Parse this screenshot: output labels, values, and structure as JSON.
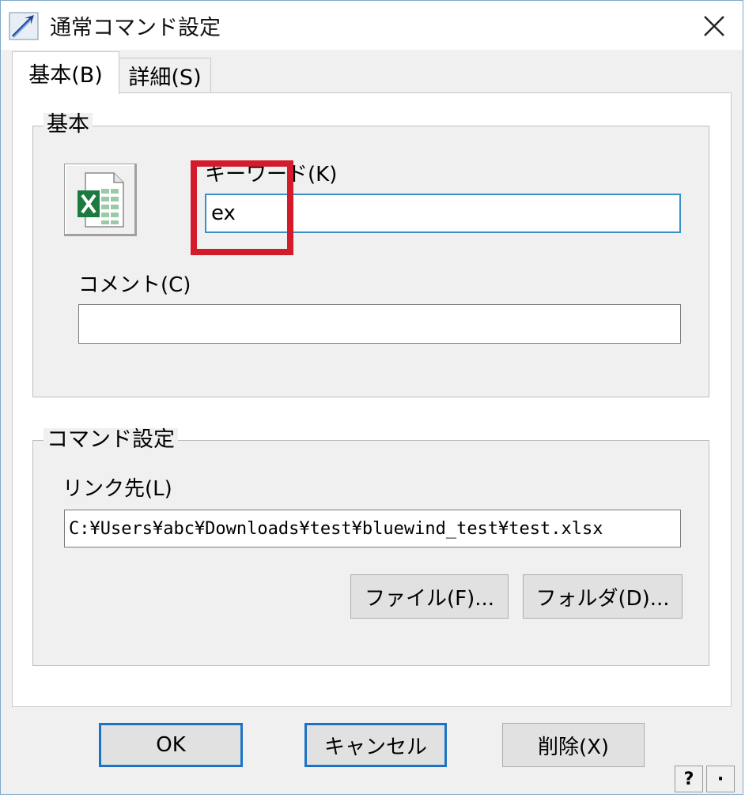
{
  "window": {
    "title": "通常コマンド設定",
    "icon": "app-arrow-icon",
    "close_icon": "close-icon"
  },
  "tabs": [
    {
      "label": "基本(B)",
      "active": true
    },
    {
      "label": "詳細(S)",
      "active": false
    }
  ],
  "basic_group": {
    "label": "基本",
    "icon": "excel-file-icon",
    "keyword_label": "キーワード(K)",
    "keyword_value": "ex",
    "comment_label": "コメント(C)",
    "comment_value": ""
  },
  "command_group": {
    "label": "コマンド設定",
    "link_label": "リンク先(L)",
    "link_value": "C:¥Users¥abc¥Downloads¥test¥bluewind_test¥test.xlsx",
    "file_button": "ファイル(F)...",
    "folder_button": "フォルダ(D)..."
  },
  "footer": {
    "ok": "OK",
    "cancel": "キャンセル",
    "delete": "削除(X)",
    "help": "?",
    "extra": "·"
  },
  "highlight_color": "#d31c2b"
}
